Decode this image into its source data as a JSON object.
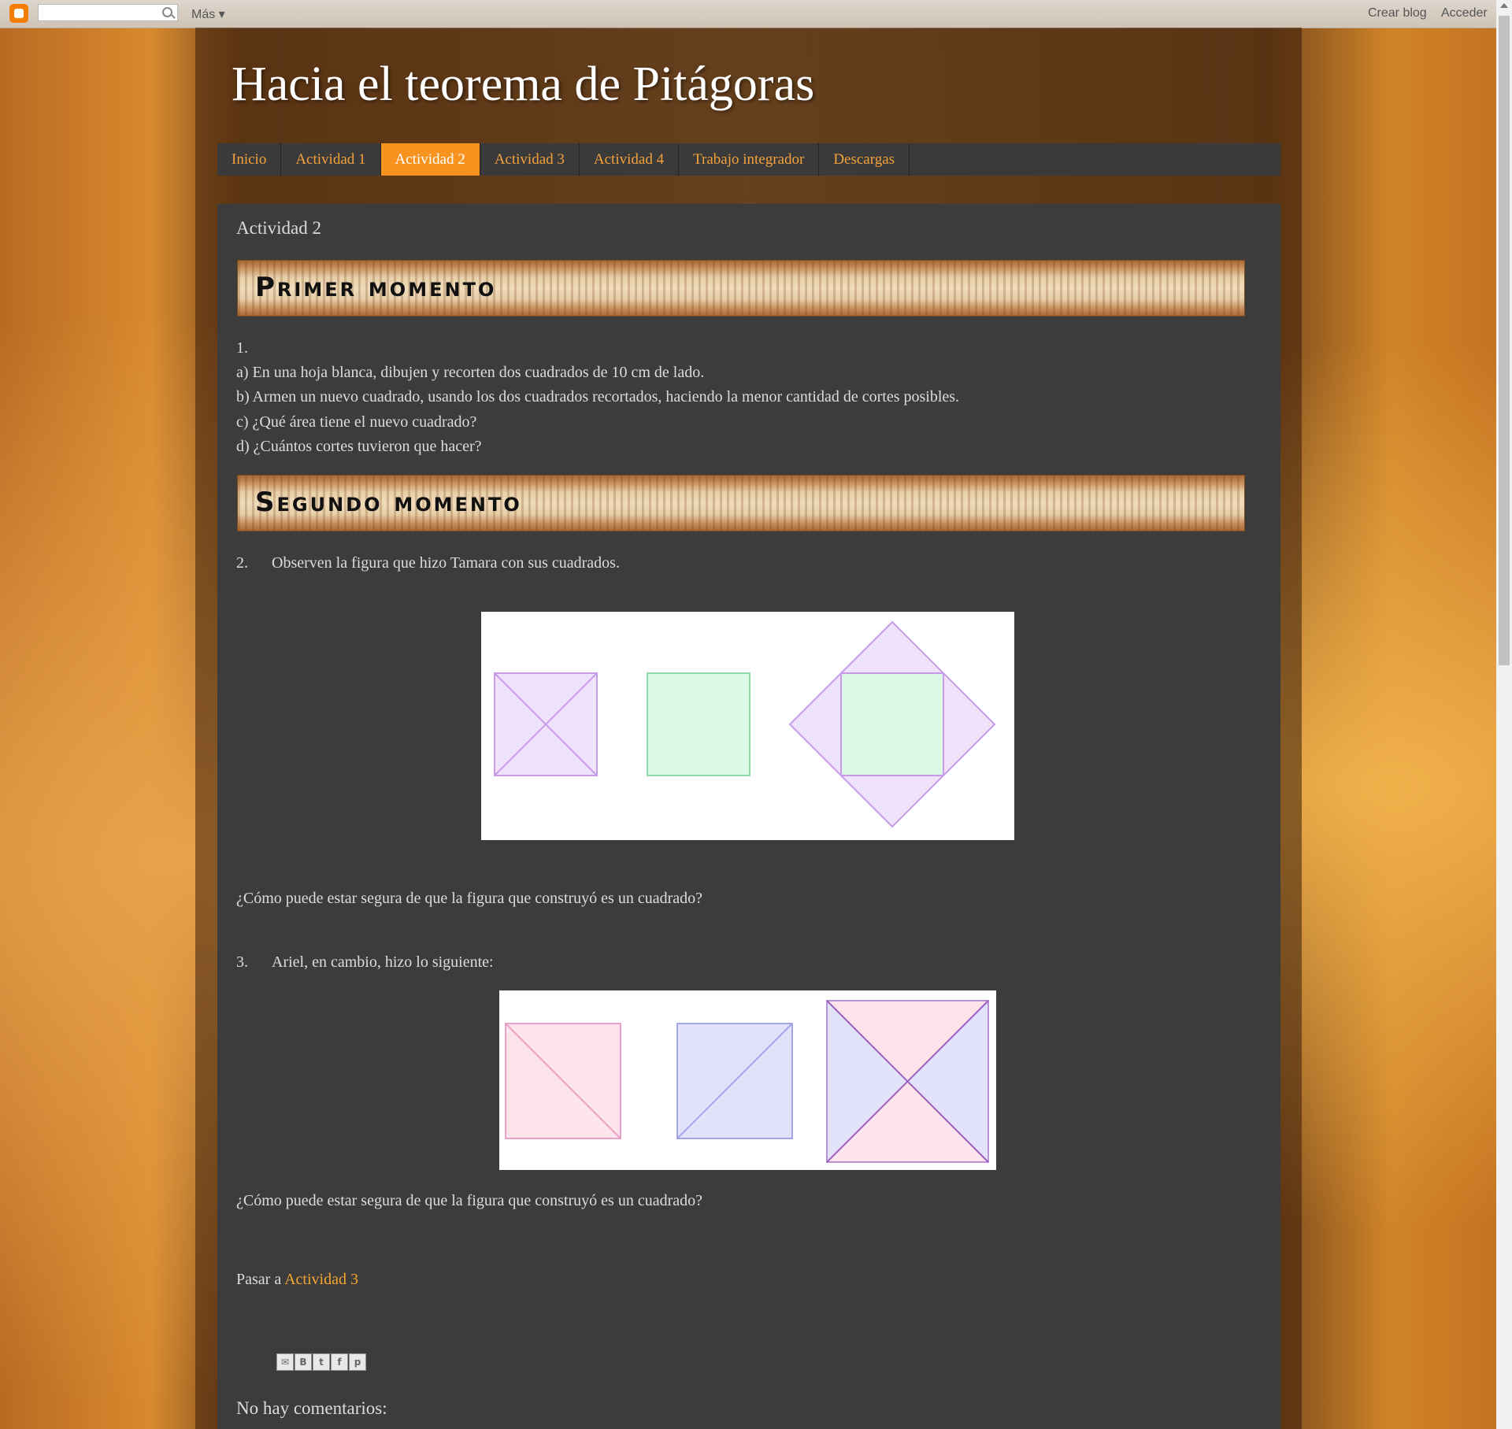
{
  "navbar": {
    "more_label": "Más ▾",
    "create_blog": "Crear blog",
    "sign_in": "Acceder"
  },
  "blog": {
    "title": "Hacia el teorema de Pitágoras"
  },
  "tabs": [
    {
      "label": "Inicio"
    },
    {
      "label": "Actividad 1"
    },
    {
      "label": "Actividad 2",
      "active": true
    },
    {
      "label": "Actividad 3"
    },
    {
      "label": "Actividad 4"
    },
    {
      "label": "Trabajo integrador"
    },
    {
      "label": "Descargas"
    }
  ],
  "post": {
    "title": "Actividad 2",
    "banner1": "Primer momento",
    "q1_number": "1.",
    "q1_a": "a) En una hoja blanca, dibujen y recorten dos cuadrados de 10 cm de lado.",
    "q1_b": "b) Armen un nuevo cuadrado, usando los dos cuadrados recortados, haciendo la menor cantidad de cortes posibles.",
    "q1_c": "c) ¿Qué área tiene el nuevo cuadrado?",
    "q1_d": "d) ¿Cuántos cortes tuvieron que hacer?",
    "banner2": "Segundo momento",
    "q2_number": "2.",
    "q2_text": "Observen la figura que hizo Tamara con sus cuadrados.",
    "q2_question": "¿Cómo puede estar segura de que la figura que construyó es un cuadrado?",
    "q3_number": "3.",
    "q3_text": "Ariel, en cambio, hizo lo siguiente:",
    "q3_question": "¿Cómo puede estar segura de que la figura que construyó es un cuadrado?",
    "next_prefix": "Pasar a",
    "next_link": "Actividad 3",
    "comments": "No hay comentarios:"
  },
  "share_buttons": [
    "email-icon",
    "blogger-icon",
    "twitter-icon",
    "facebook-icon",
    "pinterest-icon"
  ],
  "colors": {
    "accent": "#f7931e",
    "link": "#f7a531",
    "purple_fill": "#efe3fb",
    "purple_stroke": "#c79be8",
    "green_fill": "#dcf8e6",
    "green_stroke": "#8fdca9",
    "pink_fill": "#fde3ea",
    "pink_stroke": "#e7a3c8",
    "blue_fill": "#e2e3fb",
    "blue_stroke": "#a3a6e6"
  }
}
